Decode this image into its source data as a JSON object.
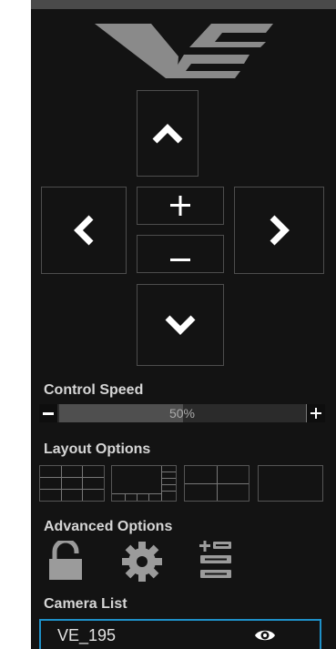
{
  "speed": {
    "title": "Control Speed",
    "value_label": "50%",
    "value": 0.5
  },
  "layout": {
    "title": "Layout Options"
  },
  "advanced": {
    "title": "Advanced Options"
  },
  "cameras": {
    "title": "Camera List",
    "items": [
      {
        "name": "VE_195"
      }
    ]
  },
  "icons": {
    "logo": "ve-logo",
    "up": "chevron-up-icon",
    "down": "chevron-down-icon",
    "left": "chevron-left-icon",
    "right": "chevron-right-icon",
    "lock": "lock-open-icon",
    "gear": "gear-icon",
    "list": "list-add-icon",
    "eye": "eye-icon"
  },
  "colors": {
    "panel": "#131313",
    "accent": "#1e90c8",
    "label": "#d6d6d6"
  }
}
